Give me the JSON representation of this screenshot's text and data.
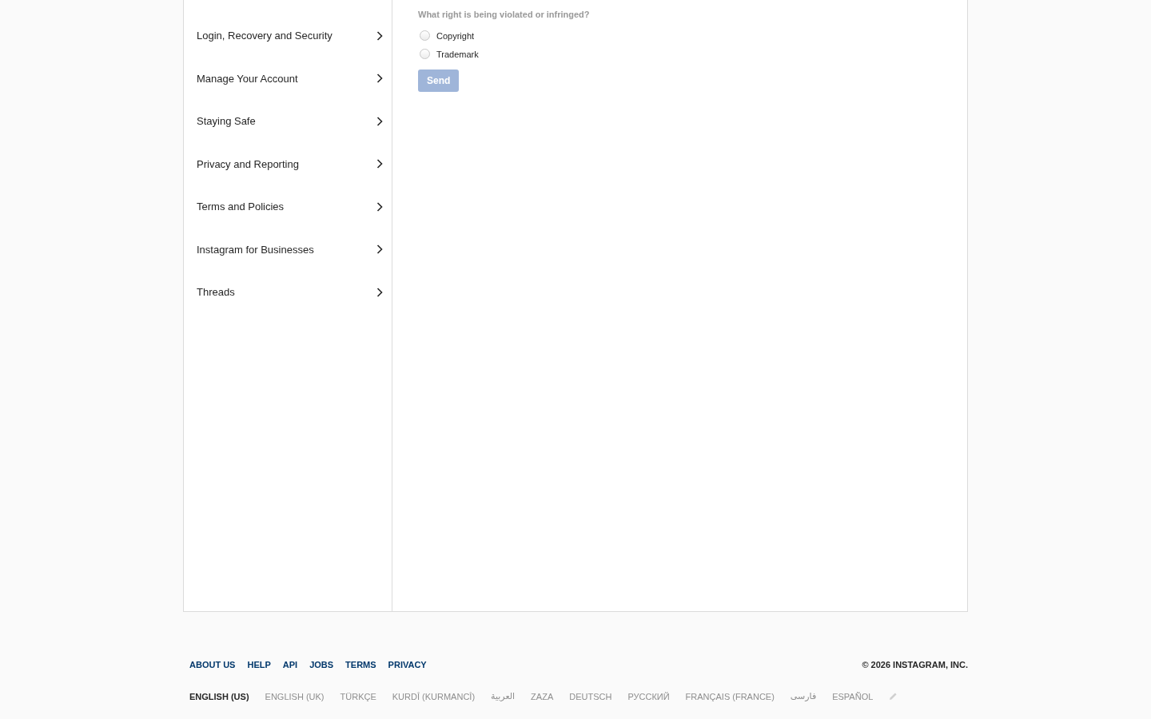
{
  "sidebar": {
    "items": [
      {
        "label": "Login, Recovery and Security"
      },
      {
        "label": "Manage Your Account"
      },
      {
        "label": "Staying Safe"
      },
      {
        "label": "Privacy and Reporting"
      },
      {
        "label": "Terms and Policies"
      },
      {
        "label": "Instagram for Businesses"
      },
      {
        "label": "Threads"
      }
    ]
  },
  "form": {
    "question": "What right is being violated or infringed?",
    "options": [
      {
        "label": "Copyright",
        "checked": false
      },
      {
        "label": "Trademark",
        "checked": false
      }
    ],
    "submit": {
      "label": "Send",
      "disabled": true
    }
  },
  "footer": {
    "links": [
      "ABOUT US",
      "HELP",
      "API",
      "JOBS",
      "TERMS",
      "PRIVACY"
    ],
    "copyright": "© 2026 INSTAGRAM, INC.",
    "languages": [
      {
        "label": "ENGLISH (US)",
        "selected": true
      },
      {
        "label": "ENGLISH (UK)",
        "selected": false
      },
      {
        "label": "TÜRKÇE",
        "selected": false
      },
      {
        "label": "KURDÎ (KURMANCÎ)",
        "selected": false
      },
      {
        "label": "العربية",
        "selected": false
      },
      {
        "label": "ZAZA",
        "selected": false
      },
      {
        "label": "DEUTSCH",
        "selected": false
      },
      {
        "label": "РУССКИЙ",
        "selected": false
      },
      {
        "label": "FRANÇAIS (FRANCE)",
        "selected": false
      },
      {
        "label": "فارسی",
        "selected": false
      },
      {
        "label": "ESPAÑOL",
        "selected": false
      }
    ]
  }
}
